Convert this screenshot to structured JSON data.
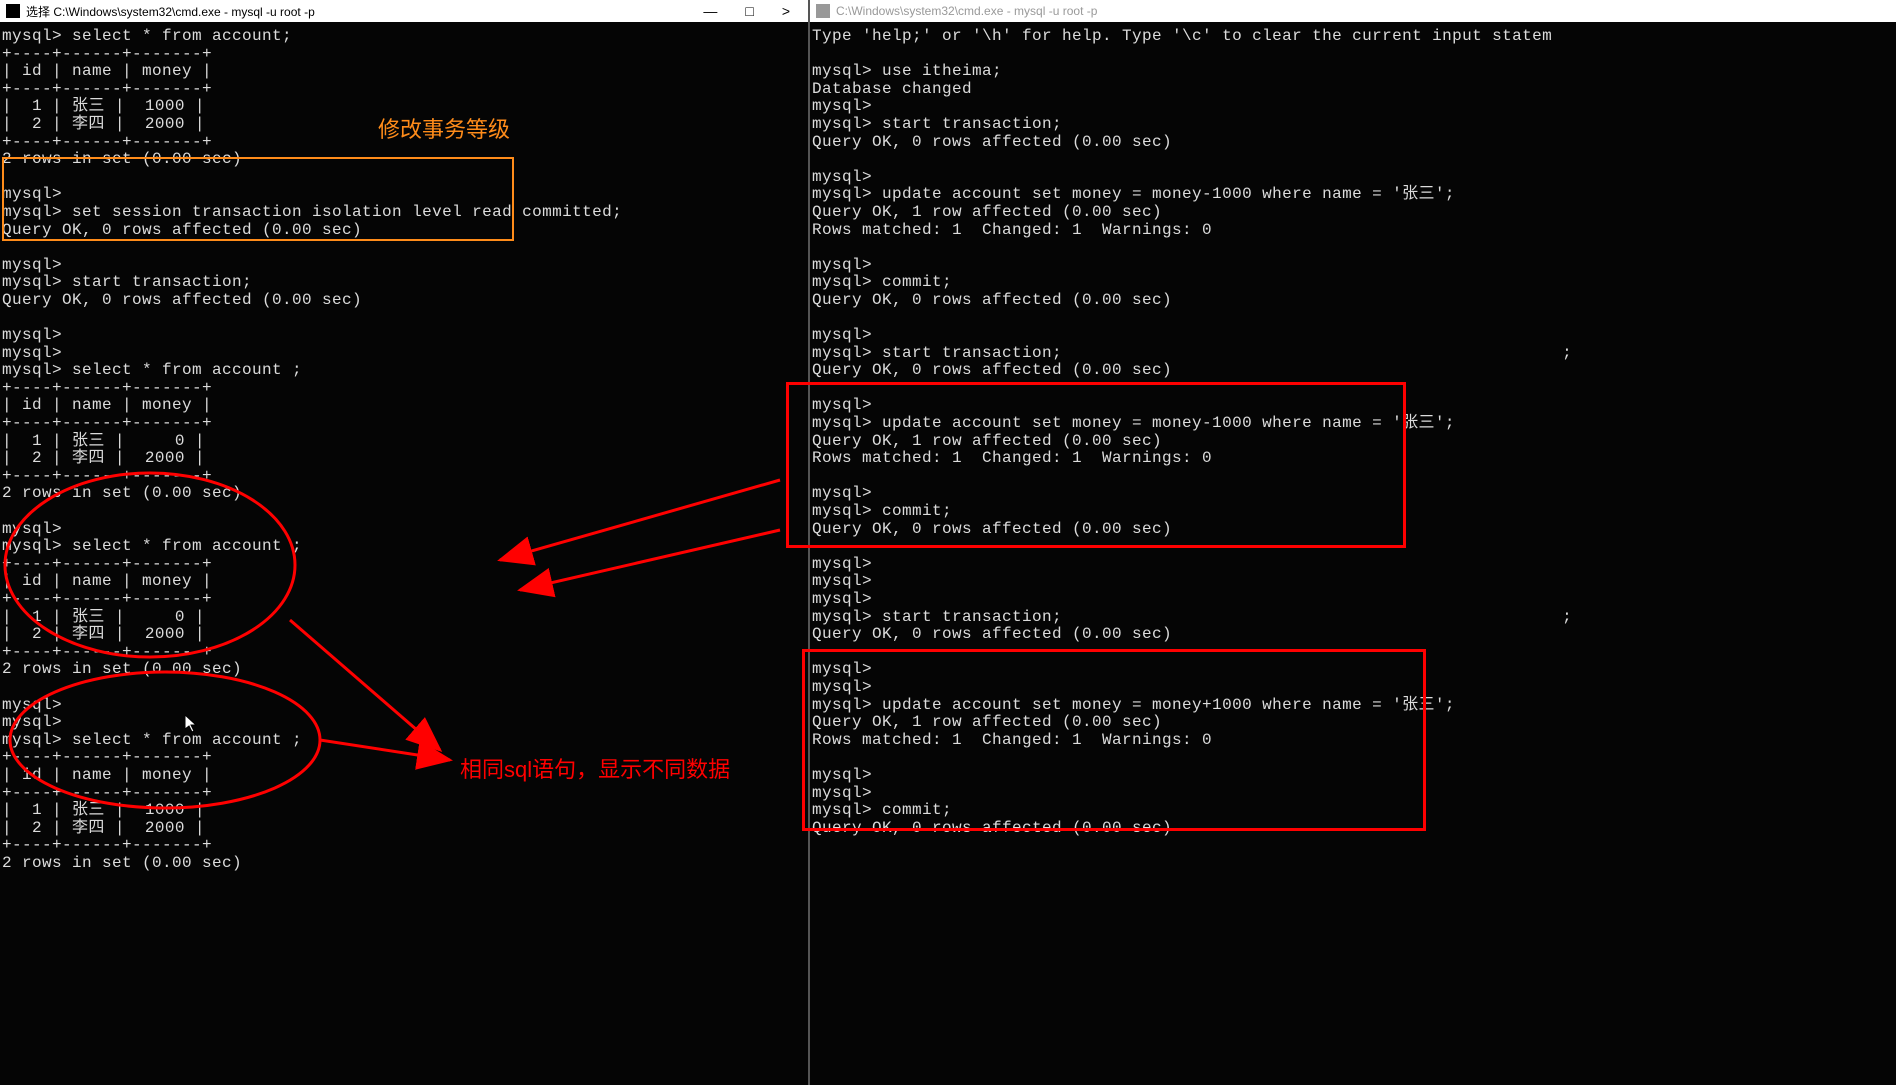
{
  "left_window": {
    "title": "选择 C:\\Windows\\system32\\cmd.exe - mysql  -u root -p",
    "terminal_text": "mysql> select * from account;\n+----+------+-------+\n| id | name | money |\n+----+------+-------+\n|  1 | 张三 |  1000 |\n|  2 | 李四 |  2000 |\n+----+------+-------+\n2 rows in set (0.00 sec)\n\nmysql>\nmysql> set session transaction isolation level read committed;\nQuery OK, 0 rows affected (0.00 sec)\n\nmysql>\nmysql> start transaction;\nQuery OK, 0 rows affected (0.00 sec)\n\nmysql>\nmysql>\nmysql> select * from account ;\n+----+------+-------+\n| id | name | money |\n+----+------+-------+\n|  1 | 张三 |     0 |\n|  2 | 李四 |  2000 |\n+----+------+-------+\n2 rows in set (0.00 sec)\n\nmysql>\nmysql> select * from account ;\n+----+------+-------+\n| id | name | money |\n+----+------+-------+\n|  1 | 张三 |     0 |\n|  2 | 李四 |  2000 |\n+----+------+-------+\n2 rows in set (0.00 sec)\n\nmysql>\nmysql>\nmysql> select * from account ;\n+----+------+-------+\n| id | name | money |\n+----+------+-------+\n|  1 | 张三 |  1000 |\n|  2 | 李四 |  2000 |\n+----+------+-------+\n2 rows in set (0.00 sec)"
  },
  "right_window": {
    "title": "C:\\Windows\\system32\\cmd.exe - mysql  -u root -p",
    "terminal_text": "Type 'help;' or '\\h' for help. Type '\\c' to clear the current input statem\n\nmysql> use itheima;\nDatabase changed\nmysql>\nmysql> start transaction;\nQuery OK, 0 rows affected (0.00 sec)\n\nmysql>\nmysql> update account set money = money-1000 where name = '张三';\nQuery OK, 1 row affected (0.00 sec)\nRows matched: 1  Changed: 1  Warnings: 0\n\nmysql>\nmysql> commit;\nQuery OK, 0 rows affected (0.00 sec)\n\nmysql>\nmysql> start transaction;                                                  ;\nQuery OK, 0 rows affected (0.00 sec)\n\nmysql>\nmysql> update account set money = money-1000 where name = '张三';\nQuery OK, 1 row affected (0.00 sec)\nRows matched: 1  Changed: 1  Warnings: 0\n\nmysql>\nmysql> commit;\nQuery OK, 0 rows affected (0.00 sec)\n\nmysql>\nmysql>\nmysql>\nmysql> start transaction;                                                  ;\nQuery OK, 0 rows affected (0.00 sec)\n\nmysql>\nmysql>\nmysql> update account set money = money+1000 where name = '张三';\nQuery OK, 1 row affected (0.00 sec)\nRows matched: 1  Changed: 1  Warnings: 0\n\nmysql>\nmysql>\nmysql> commit;\nQuery OK, 0 rows affected (0.00 sec)"
  },
  "annotations": {
    "orange_label": "修改事务等级",
    "red_label": "相同sql语句，显示不同数据"
  }
}
